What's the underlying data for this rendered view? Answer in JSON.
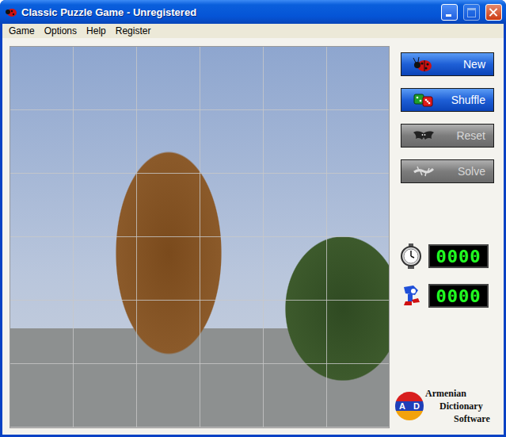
{
  "window": {
    "title": "Classic Puzzle Game - Unregistered",
    "controls": [
      {
        "kind": "minimize",
        "disabled": false
      },
      {
        "kind": "maximize",
        "disabled": true
      },
      {
        "kind": "close",
        "disabled": false
      }
    ]
  },
  "menu": [
    "Game",
    "Options",
    "Help",
    "Register"
  ],
  "buttons": [
    {
      "label": "New",
      "kind": "new",
      "disabled": false
    },
    {
      "label": "Shuffle",
      "kind": "shuffle",
      "disabled": false
    },
    {
      "label": "Reset",
      "kind": "reset",
      "disabled": true
    },
    {
      "label": "Solve",
      "kind": "solve",
      "disabled": true
    }
  ],
  "counters": [
    {
      "kind": "time",
      "value": "0000"
    },
    {
      "kind": "moves",
      "value": "0000"
    }
  ],
  "logo": {
    "letters": [
      "A",
      "D"
    ],
    "lines": [
      "Armenian",
      "Dictionary",
      "Software"
    ]
  }
}
